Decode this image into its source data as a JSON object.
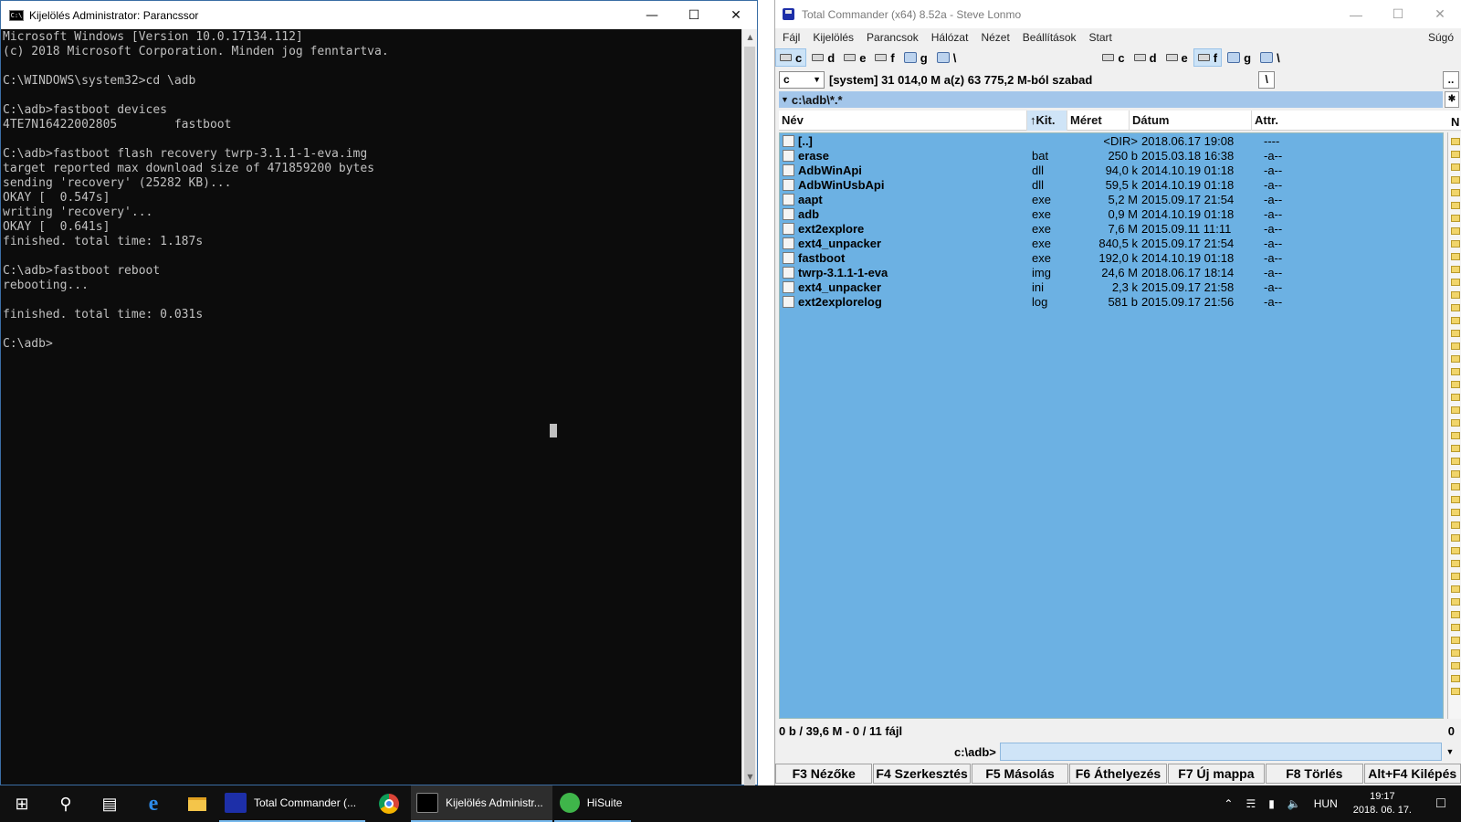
{
  "cmd": {
    "title": "Kijelölés Administrator: Parancssor",
    "console_lines": [
      "Microsoft Windows [Version 10.0.17134.112]",
      "(c) 2018 Microsoft Corporation. Minden jog fenntartva.",
      "",
      "C:\\WINDOWS\\system32>cd \\adb",
      "",
      "C:\\adb>fastboot devices",
      "4TE7N16422002805        fastboot",
      "",
      "C:\\adb>fastboot flash recovery twrp-3.1.1-1-eva.img",
      "target reported max download size of 471859200 bytes",
      "sending 'recovery' (25282 KB)...",
      "OKAY [  0.547s]",
      "writing 'recovery'...",
      "OKAY [  0.641s]",
      "finished. total time: 1.187s",
      "",
      "C:\\adb>fastboot reboot",
      "rebooting...",
      "",
      "finished. total time: 0.031s",
      "",
      "C:\\adb>"
    ]
  },
  "tc": {
    "title": "Total Commander (x64) 8.52a - Steve Lonmo",
    "menu": [
      "Fájl",
      "Kijelölés",
      "Parancsok",
      "Hálózat",
      "Nézet",
      "Beállítások",
      "Start"
    ],
    "menu_help": "Súgó",
    "drives_left": [
      "c",
      "d",
      "e",
      "f",
      "g",
      "\\"
    ],
    "drives_right": [
      "c",
      "d",
      "e",
      "f",
      "g",
      "\\"
    ],
    "drive_combo": "c",
    "drive_info": "[system]  31 014,0 M a(z) 63 775,2 M-ból szabad",
    "path_btn_root": "\\",
    "path_btn_up": "..",
    "current_path": "c:\\adb\\*.*",
    "columns": {
      "name": "Név",
      "ext": "Kit.",
      "size": "Méret",
      "date": "Dátum",
      "attr": "Attr."
    },
    "files": [
      {
        "name": "[..]",
        "ext": "",
        "size": "<DIR>",
        "date": "2018.06.17 19:08",
        "attr": "----"
      },
      {
        "name": "erase",
        "ext": "bat",
        "size": "250 b",
        "date": "2015.03.18 16:38",
        "attr": "-a--"
      },
      {
        "name": "AdbWinApi",
        "ext": "dll",
        "size": "94,0 k",
        "date": "2014.10.19 01:18",
        "attr": "-a--"
      },
      {
        "name": "AdbWinUsbApi",
        "ext": "dll",
        "size": "59,5 k",
        "date": "2014.10.19 01:18",
        "attr": "-a--"
      },
      {
        "name": "aapt",
        "ext": "exe",
        "size": "5,2 M",
        "date": "2015.09.17 21:54",
        "attr": "-a--"
      },
      {
        "name": "adb",
        "ext": "exe",
        "size": "0,9 M",
        "date": "2014.10.19 01:18",
        "attr": "-a--"
      },
      {
        "name": "ext2explore",
        "ext": "exe",
        "size": "7,6 M",
        "date": "2015.09.11 11:11",
        "attr": "-a--"
      },
      {
        "name": "ext4_unpacker",
        "ext": "exe",
        "size": "840,5 k",
        "date": "2015.09.17 21:54",
        "attr": "-a--"
      },
      {
        "name": "fastboot",
        "ext": "exe",
        "size": "192,0 k",
        "date": "2014.10.19 01:18",
        "attr": "-a--"
      },
      {
        "name": "twrp-3.1.1-1-eva",
        "ext": "img",
        "size": "24,6 M",
        "date": "2018.06.17 18:14",
        "attr": "-a--"
      },
      {
        "name": "ext4_unpacker",
        "ext": "ini",
        "size": "2,3 k",
        "date": "2015.09.17 21:58",
        "attr": "-a--"
      },
      {
        "name": "ext2explorelog",
        "ext": "log",
        "size": "581 b",
        "date": "2015.09.17 21:56",
        "attr": "-a--"
      }
    ],
    "right_col_letter": "N",
    "status": "0 b / 39,6 M - 0 / 11 fájl",
    "status_right": "0",
    "cmd_prompt": "c:\\adb>",
    "fkeys": [
      "F3 Nézőke",
      "F4 Szerkesztés",
      "F5 Másolás",
      "F6 Áthelyezés",
      "F7 Új mappa",
      "F8 Törlés",
      "Alt+F4 Kilépés"
    ],
    "colors": {
      "panel_bg": "#6cb1e3",
      "path_bg": "#a3c6ea"
    }
  },
  "taskbar": {
    "apps": [
      {
        "label": "Total Commander (...",
        "icon": "total-commander-icon",
        "active": false
      },
      {
        "label": "Kijelölés Administr...",
        "icon": "cmd-icon",
        "active": true
      },
      {
        "label": "HiSuite",
        "icon": "hisuite-icon",
        "active": false
      }
    ],
    "language": "HUN",
    "time": "19:17",
    "date": "2018. 06. 17."
  }
}
